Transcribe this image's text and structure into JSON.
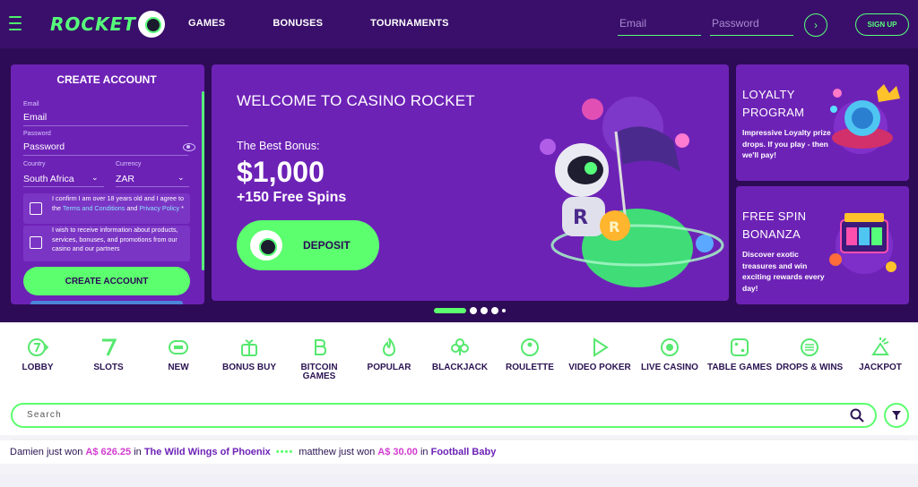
{
  "header": {
    "brand": "ROCKET",
    "nav": [
      "GAMES",
      "BONUSES",
      "TOURNAMENTS"
    ],
    "email_placeholder": "Email",
    "password_placeholder": "Password",
    "go_icon": "chevron-right-icon",
    "signup_label": "SIGN UP"
  },
  "create_account": {
    "title": "CREATE ACCOUNT",
    "email_label": "Email",
    "email_value": "Email",
    "password_label": "Password",
    "password_value": "Password",
    "country_label": "Country",
    "country_value": "South Africa",
    "currency_label": "Currency",
    "currency_value": "ZAR",
    "age_text_1": "I confirm I am over 18 years old and I agree to the ",
    "age_link_1": "Terms and Conditions",
    "age_text_2": " and ",
    "age_link_2": "Privacy Policy",
    "age_text_3": " *",
    "marketing_text": "I wish to receive information about products, services, bonuses, and promotions from our casino and our partners",
    "button_label": "CREATE ACCOUNT"
  },
  "welcome": {
    "title": "WELCOME TO CASINO ROCKET",
    "bonus_label": "The Best Bonus:",
    "bonus_amount": "$1,000",
    "bonus_spins": "+150 Free Spins",
    "deposit_label": "DEPOSIT"
  },
  "loyalty": {
    "title": "LOYALTY PROGRAM",
    "description": "Impressive Loyalty prize drops. If you play - then we'll pay!"
  },
  "free_spin": {
    "title": "FREE SPIN BONANZA",
    "description": "Discover exotic treasures and win exciting rewards every day!"
  },
  "carousel": {
    "active_index": 0,
    "count": 5
  },
  "categories": [
    {
      "label": "LOBBY",
      "icon": "lobby-icon"
    },
    {
      "label": "SLOTS",
      "icon": "slots-icon"
    },
    {
      "label": "NEW",
      "icon": "new-icon"
    },
    {
      "label": "BONUS BUY",
      "icon": "gift-icon"
    },
    {
      "label": "BITCOIN GAMES",
      "icon": "bitcoin-icon"
    },
    {
      "label": "POPULAR",
      "icon": "flame-icon"
    },
    {
      "label": "BLACKJACK",
      "icon": "club-icon"
    },
    {
      "label": "ROULETTE",
      "icon": "roulette-icon"
    },
    {
      "label": "VIDEO POKER",
      "icon": "play-icon"
    },
    {
      "label": "LIVE CASINO",
      "icon": "live-icon"
    },
    {
      "label": "TABLE GAMES",
      "icon": "dice-icon"
    },
    {
      "label": "DROPS & WINS",
      "icon": "drops-icon"
    },
    {
      "label": "JACKPOT",
      "icon": "jackpot-icon"
    }
  ],
  "search": {
    "placeholder": "Search"
  },
  "ticker": [
    {
      "user": "Damien",
      "text": " just won ",
      "amount": "A$ 626.25",
      "in": " in ",
      "game": "The Wild Wings of Phoenix"
    },
    {
      "user": "matthew",
      "text": " just won ",
      "amount": "A$ 30.00",
      "in": " in ",
      "game": "Football Baby"
    }
  ],
  "colors": {
    "accent": "#5cff6e",
    "panel": "#6d22b6",
    "header": "#3a0f6b"
  }
}
